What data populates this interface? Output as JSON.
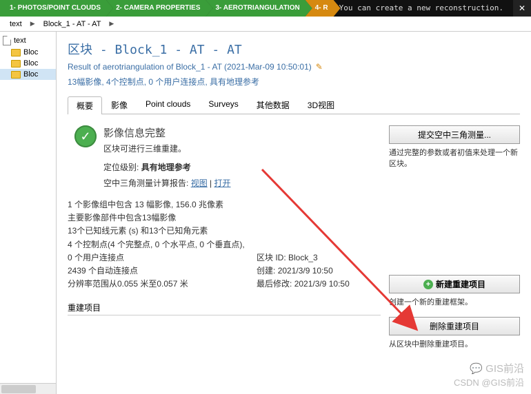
{
  "steps": {
    "s1": "1- PHOTOS/POINT CLOUDS",
    "s2": "2- CAMERA PROPERTIES",
    "s3": "3- AEROTRIANGULATION",
    "s4": "4- R"
  },
  "top_msg": "You can create a new reconstruction.",
  "close": "✕",
  "breadcrumb": {
    "b1": "text",
    "b2": "Block_1 - AT - AT"
  },
  "tree": {
    "t0": "text",
    "t1": "Bloc",
    "t2": "Bloc",
    "t3": "Bloc"
  },
  "header": {
    "title": "区块 - Block_1 - AT - AT",
    "subtitle": "Result of aerotriangulation of Block_1 - AT (2021-Mar-09 10:50:01)",
    "summary": "13幅影像, 4个控制点, 0 个用户连接点, 具有地理参考"
  },
  "tabs": {
    "t1": "概要",
    "t2": "影像",
    "t3": "Point clouds",
    "t4": "Surveys",
    "t5": "其他数据",
    "t6": "3D视图"
  },
  "info": {
    "title": "影像信息完整",
    "sub": "区块可进行三维重建。",
    "pos_label": "定位级别:",
    "pos_value": "具有地理参考",
    "report_label": "空中三角测量计算报告:",
    "view": "视图",
    "open": "打开",
    "sep": " | "
  },
  "stats": {
    "l1": "1 个影像组中包含 13 幅影像, 156.0 兆像素",
    "l2": "主要影像部件中包含13幅影像",
    "l3": "13个已知线元素 (s) 和13个已知角元素",
    "l4": "4 个控制点(4 个完整点, 0 个水平点, 0 个垂直点),",
    "l5": "0 个用户连接点",
    "l6": "2439 个自动连接点",
    "l7": "分辨率范围从0.055 米至0.057 米",
    "r1_label": "区块 ID:",
    "r1_val": "Block_3",
    "r2_label": "创建:",
    "r2_val": "2021/3/9 10:50",
    "r3_label": "最后修改:",
    "r3_val": "2021/3/9 10:50"
  },
  "right": {
    "btn1": "提交空中三角测量...",
    "desc1": "通过完整的参数或者初值来处理一个新区块。",
    "btn2": "新建重建项目",
    "desc2": "创建一个新的重建框架。",
    "btn3": "删除重建项目",
    "desc3": "从区块中删除重建项目。"
  },
  "section": {
    "rebuild": "重建项目"
  },
  "watermark": {
    "top": "GIS前沿",
    "bottom": "CSDN @GIS前沿"
  }
}
